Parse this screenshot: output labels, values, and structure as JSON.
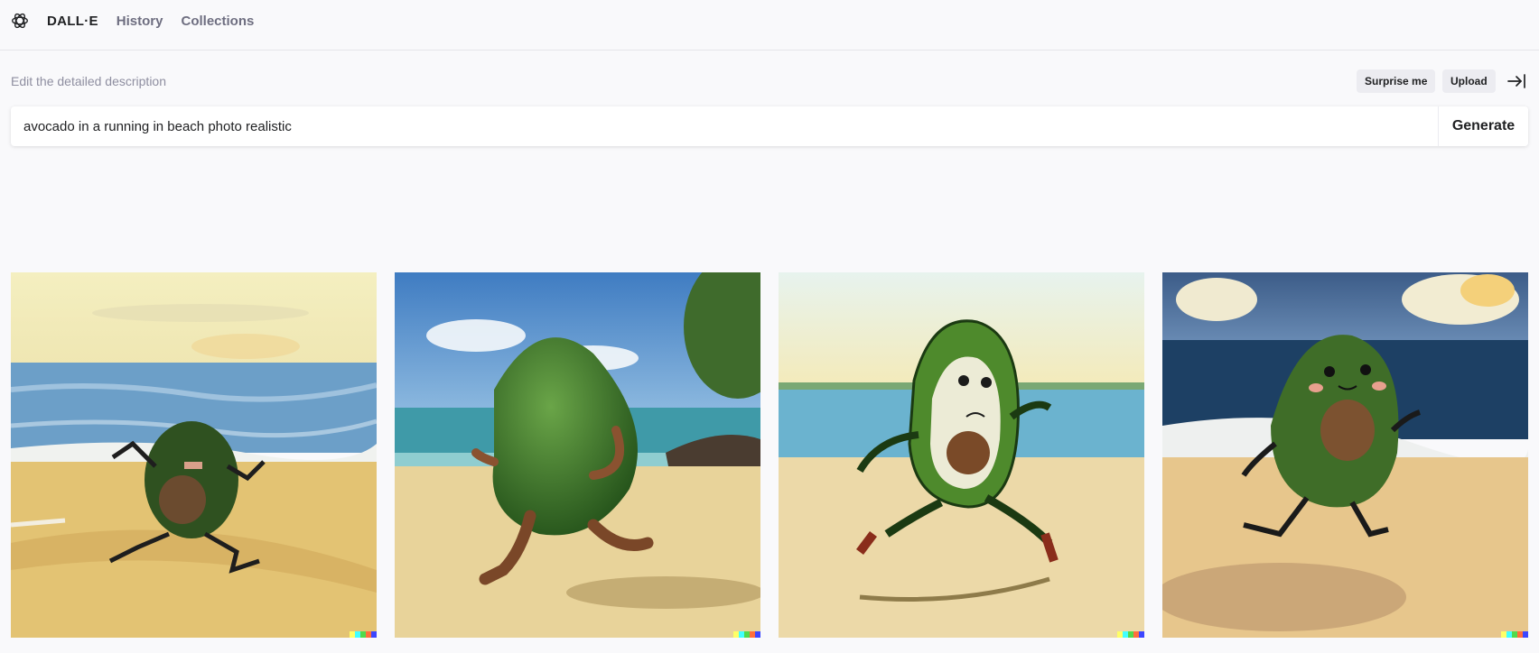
{
  "header": {
    "brand": "DALL·E",
    "nav": [
      "History",
      "Collections"
    ]
  },
  "editor": {
    "label": "Edit the detailed description",
    "surprise_label": "Surprise me",
    "upload_label": "Upload",
    "prompt_value": "avocado in a running in beach photo realistic",
    "generate_label": "Generate"
  },
  "gallery": {
    "images": [
      "avocado-running-beach-painting-1",
      "avocado-running-beach-photo-2",
      "avocado-running-beach-cartoon-3",
      "avocado-running-beach-cartoon-4"
    ]
  },
  "colors": {
    "signature": [
      "#ffff66",
      "#42ffff",
      "#51da4c",
      "#ff6e3c",
      "#3c46ff"
    ]
  }
}
